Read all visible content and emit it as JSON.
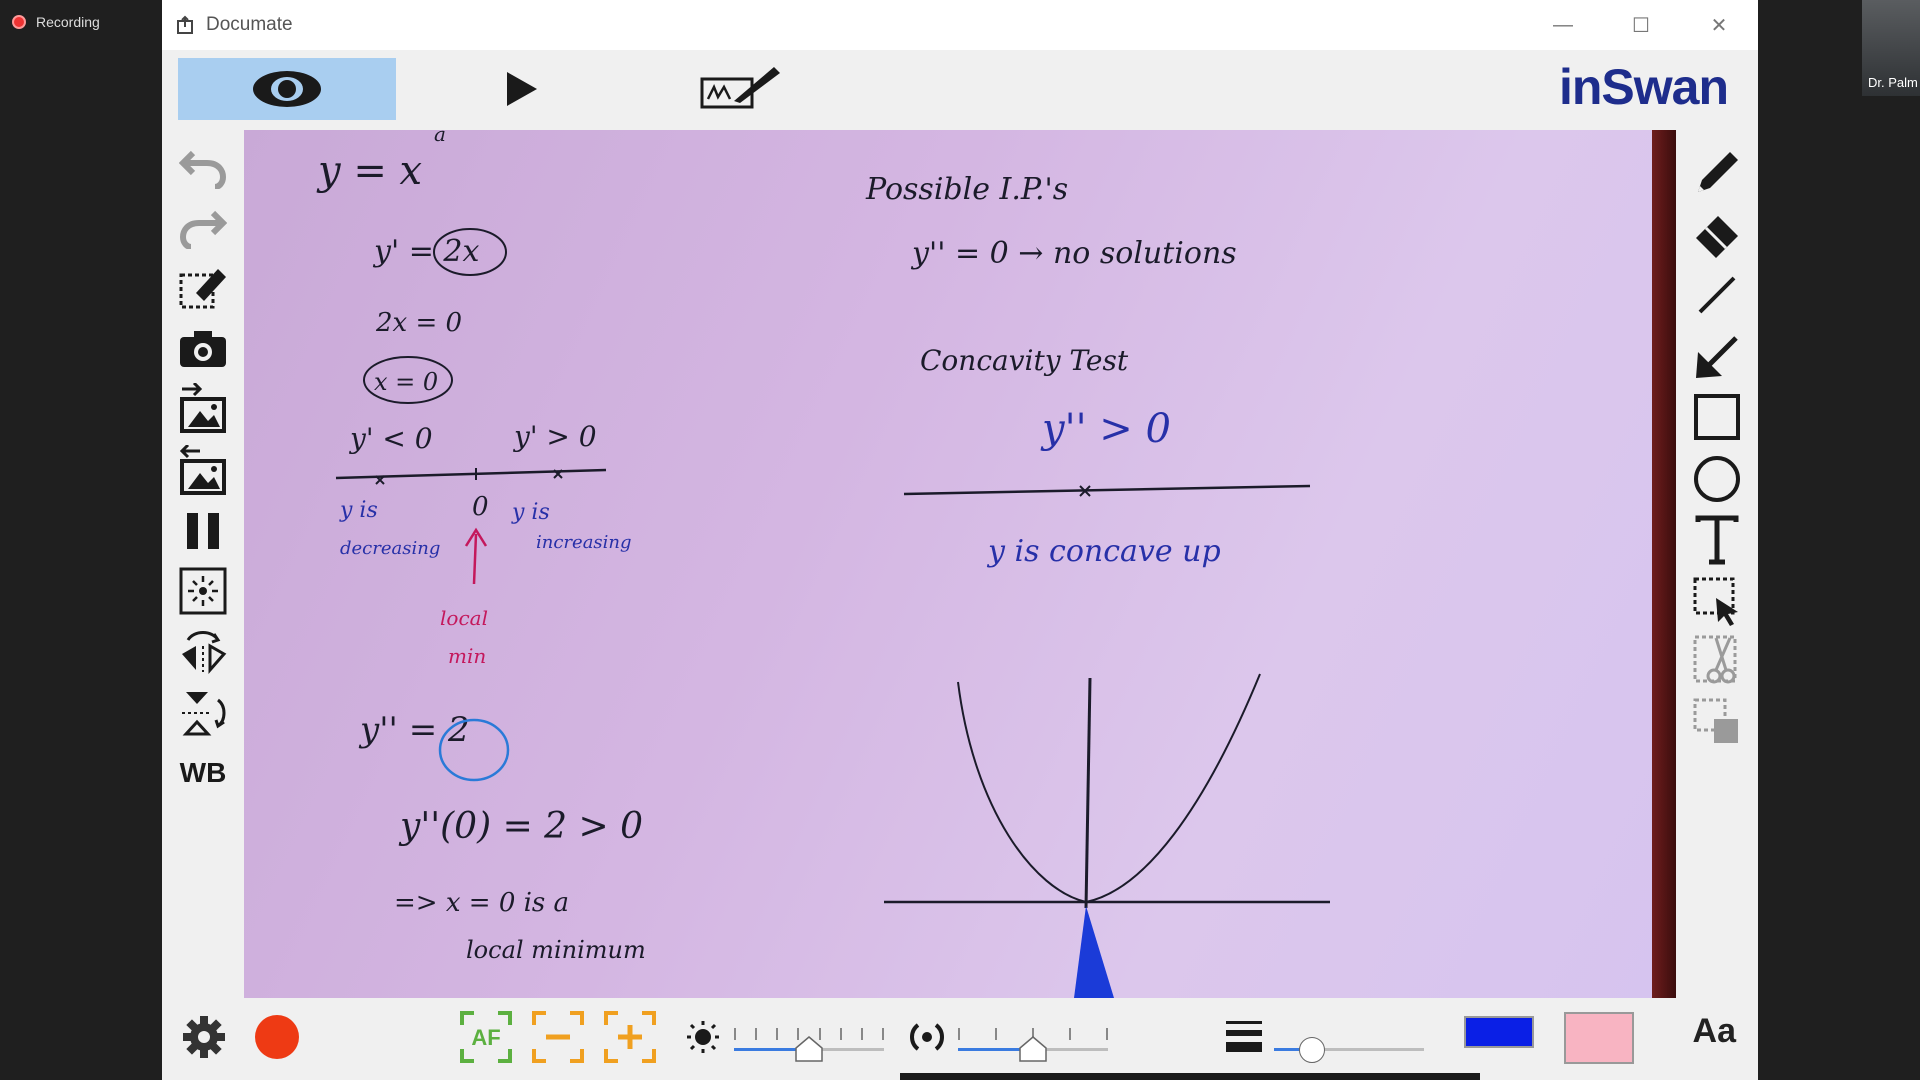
{
  "taskbar": {
    "recording_label": "Recording",
    "camera_name": "Dr. Palm"
  },
  "window": {
    "title": "Documate",
    "controls": [
      "—",
      "☐",
      "✕"
    ]
  },
  "toolbar": {
    "logo_text": "inSwan",
    "modes": [
      "preview-mode",
      "play-mode",
      "annotate-mode"
    ]
  },
  "left_tools": {
    "whiteboard_label": "WB"
  },
  "whiteboard": {
    "lines": [
      {
        "id": "l1",
        "text": "y = x",
        "color": "dark"
      },
      {
        "id": "l1sup",
        "text": "a",
        "color": "dark"
      },
      {
        "id": "l2",
        "text": "y' = 2x",
        "color": "dark"
      },
      {
        "id": "l3",
        "text": "2x = 0",
        "color": "dark"
      },
      {
        "id": "l4",
        "text": "x = 0",
        "color": "dark"
      },
      {
        "id": "l5",
        "text": "y' < 0",
        "color": "dark"
      },
      {
        "id": "l6",
        "text": "y' > 0",
        "color": "dark"
      },
      {
        "id": "l7",
        "text": "y is",
        "color": "blue"
      },
      {
        "id": "l8",
        "text": "decreasing",
        "color": "blue"
      },
      {
        "id": "l9",
        "text": "0",
        "color": "dark"
      },
      {
        "id": "l10",
        "text": "y is",
        "color": "blue"
      },
      {
        "id": "l11",
        "text": "increasing",
        "color": "blue"
      },
      {
        "id": "l12",
        "text": "local",
        "color": "pink"
      },
      {
        "id": "l13",
        "text": "min",
        "color": "pink"
      },
      {
        "id": "l14",
        "text": "y'' = 2",
        "color": "dark"
      },
      {
        "id": "l15",
        "text": "y''(0) = 2 > 0",
        "color": "dark"
      },
      {
        "id": "l16",
        "text": "=> x = 0 is a",
        "color": "dark"
      },
      {
        "id": "l17",
        "text": "local minimum",
        "color": "dark"
      },
      {
        "id": "r1",
        "text": "Possible I.P.'s",
        "color": "dark"
      },
      {
        "id": "r2",
        "text": "y'' = 0 → no solutions",
        "color": "dark"
      },
      {
        "id": "r3",
        "text": "Concavity Test",
        "color": "dark"
      },
      {
        "id": "r4",
        "text": "y'' > 0",
        "color": "blue"
      },
      {
        "id": "r5",
        "text": "y is concave up",
        "color": "blue"
      }
    ]
  },
  "bottom": {
    "brightness_level": 0.5,
    "exposure_level": 0.5,
    "line_width_level": 0.25,
    "pen_color": "#0a1fe6",
    "highlight_color": "#f8b4c2",
    "font_button": "Aa",
    "af_label": "AF"
  }
}
